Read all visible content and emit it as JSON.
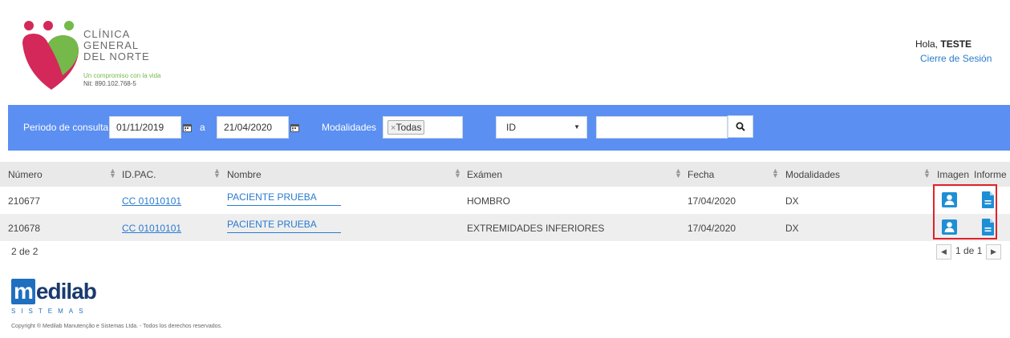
{
  "header": {
    "clinic_line1": "CLÍNICA",
    "clinic_line2": "GENERAL",
    "clinic_line3": "DEL NORTE",
    "tagline": "Un compromiso con la vida",
    "nit": "Nit: 890.102.768-5",
    "greeting_prefix": "Hola, ",
    "user": "TESTE",
    "logout": "Cierre de Sesión"
  },
  "filters": {
    "period_label": "Periodo de consulta",
    "date_from": "01/11/2019",
    "date_sep": "a",
    "date_to": "21/04/2020",
    "modalities_label": "Modalidades",
    "modality_tag": "Todas",
    "id_select": "ID",
    "search_value": ""
  },
  "table": {
    "columns": [
      "Número",
      "ID.PAC.",
      "Nombre",
      "Exámen",
      "Fecha",
      "Modalidades",
      "Imagen",
      "Informe"
    ],
    "rows": [
      {
        "numero": "210677",
        "idpac": "CC 01010101",
        "nombre": "PACIENTE PRUEBA",
        "examen": "HOMBRO",
        "fecha": "17/04/2020",
        "modalidad": "DX"
      },
      {
        "numero": "210678",
        "idpac": "CC 01010101",
        "nombre": "PACIENTE PRUEBA",
        "examen": "EXTREMIDADES INFERIORES",
        "fecha": "17/04/2020",
        "modalidad": "DX"
      }
    ]
  },
  "footer": {
    "count": "2 de 2",
    "page": "1 de 1",
    "brand": "edilab",
    "brand_m": "m",
    "brand_sub": "SISTEMAS",
    "copyright": "Copyright ® Medilab Manutenção e Sistemas Ltda. - Todos los derechos reservados."
  },
  "colors": {
    "filter_bar": "#5b8ff2",
    "link": "#2a7bd0",
    "icon_blue": "#1e8fd6",
    "highlight": "#e0222a"
  }
}
